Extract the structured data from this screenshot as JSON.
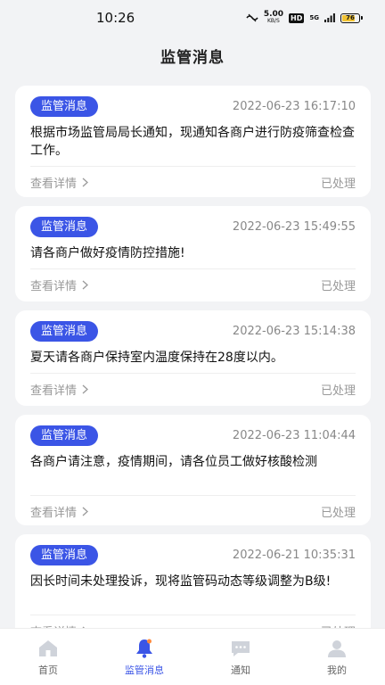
{
  "status_bar": {
    "time": "10:26",
    "net_speed": "5.00",
    "net_unit": "KB/S",
    "hd": "HD",
    "signal": "5G",
    "battery": "76"
  },
  "header": {
    "title": "监管消息"
  },
  "messages": [
    {
      "tag": "监管消息",
      "time": "2022-06-23 16:17:10",
      "content": "根据市场监管局局长通知，现通知各商户进行防疫筛查检查工作。",
      "detail_label": "查看详情",
      "status": "已处理"
    },
    {
      "tag": "监管消息",
      "time": "2022-06-23 15:49:55",
      "content": "请各商户做好疫情防控措施!",
      "detail_label": "查看详情",
      "status": "已处理"
    },
    {
      "tag": "监管消息",
      "time": "2022-06-23 15:14:38",
      "content": "夏天请各商户保持室内温度保持在28度以内。",
      "detail_label": "查看详情",
      "status": "已处理"
    },
    {
      "tag": "监管消息",
      "time": "2022-06-23 11:04:44",
      "content": "各商户请注意，疫情期间，请各位员工做好核酸检测",
      "detail_label": "查看详情",
      "status": "已处理"
    },
    {
      "tag": "监管消息",
      "time": "2022-06-21 10:35:31",
      "content": "因长时间未处理投诉，现将监管码动态等级调整为B级!",
      "detail_label": "查看详情",
      "status": "已处理"
    }
  ],
  "tabs": [
    {
      "label": "首页",
      "icon": "home-icon"
    },
    {
      "label": "监管消息",
      "icon": "bell-icon"
    },
    {
      "label": "通知",
      "icon": "chat-icon"
    },
    {
      "label": "我的",
      "icon": "user-icon"
    }
  ],
  "colors": {
    "accent": "#3b55e6",
    "inactive_icon": "#cfd3da",
    "background": "#f2f3f5"
  }
}
